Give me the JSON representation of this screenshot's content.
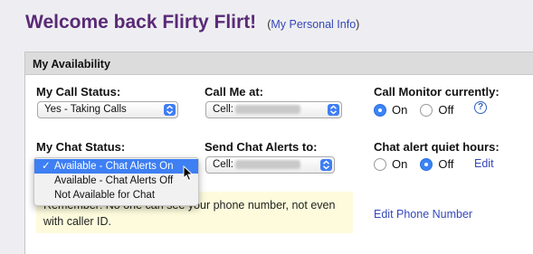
{
  "header": {
    "welcome": "Welcome back Flirty Flirt!",
    "paren_open": "(",
    "personal_link": "My Personal Info",
    "paren_close": ")"
  },
  "panel": {
    "title": "My Availability"
  },
  "call_status": {
    "label": "My Call Status:",
    "value": "Yes - Taking Calls"
  },
  "call_me_at": {
    "label": "Call Me at:",
    "prefix": "Cell:"
  },
  "call_monitor": {
    "label": "Call Monitor currently:",
    "options": [
      "On",
      "Off"
    ],
    "selected": "On",
    "help_glyph": "?"
  },
  "chat_status": {
    "label": "My Chat Status:",
    "options": [
      "Available - Chat Alerts On",
      "Available - Chat Alerts Off",
      "Not Available for Chat"
    ],
    "selected": "Available - Chat Alerts On",
    "check": "✓"
  },
  "chat_alerts": {
    "label": "Send Chat Alerts to:",
    "prefix": "Cell:"
  },
  "quiet_hours": {
    "label": "Chat alert quiet hours:",
    "options": [
      "On",
      "Off"
    ],
    "selected": "Off",
    "edit_link": "Edit"
  },
  "remember": {
    "text": "Remember: No one can see your phone number, not even with caller ID."
  },
  "edit_phone_link": "Edit Phone Number",
  "colors": {
    "title": "#5a2a76",
    "link": "#3548b8",
    "select_accent": "#3f7df4",
    "note_bg": "#fdfbdc"
  },
  "icons": [
    "chevron-updown-icon",
    "help-icon",
    "checkmark-icon",
    "mouse-pointer-icon"
  ]
}
